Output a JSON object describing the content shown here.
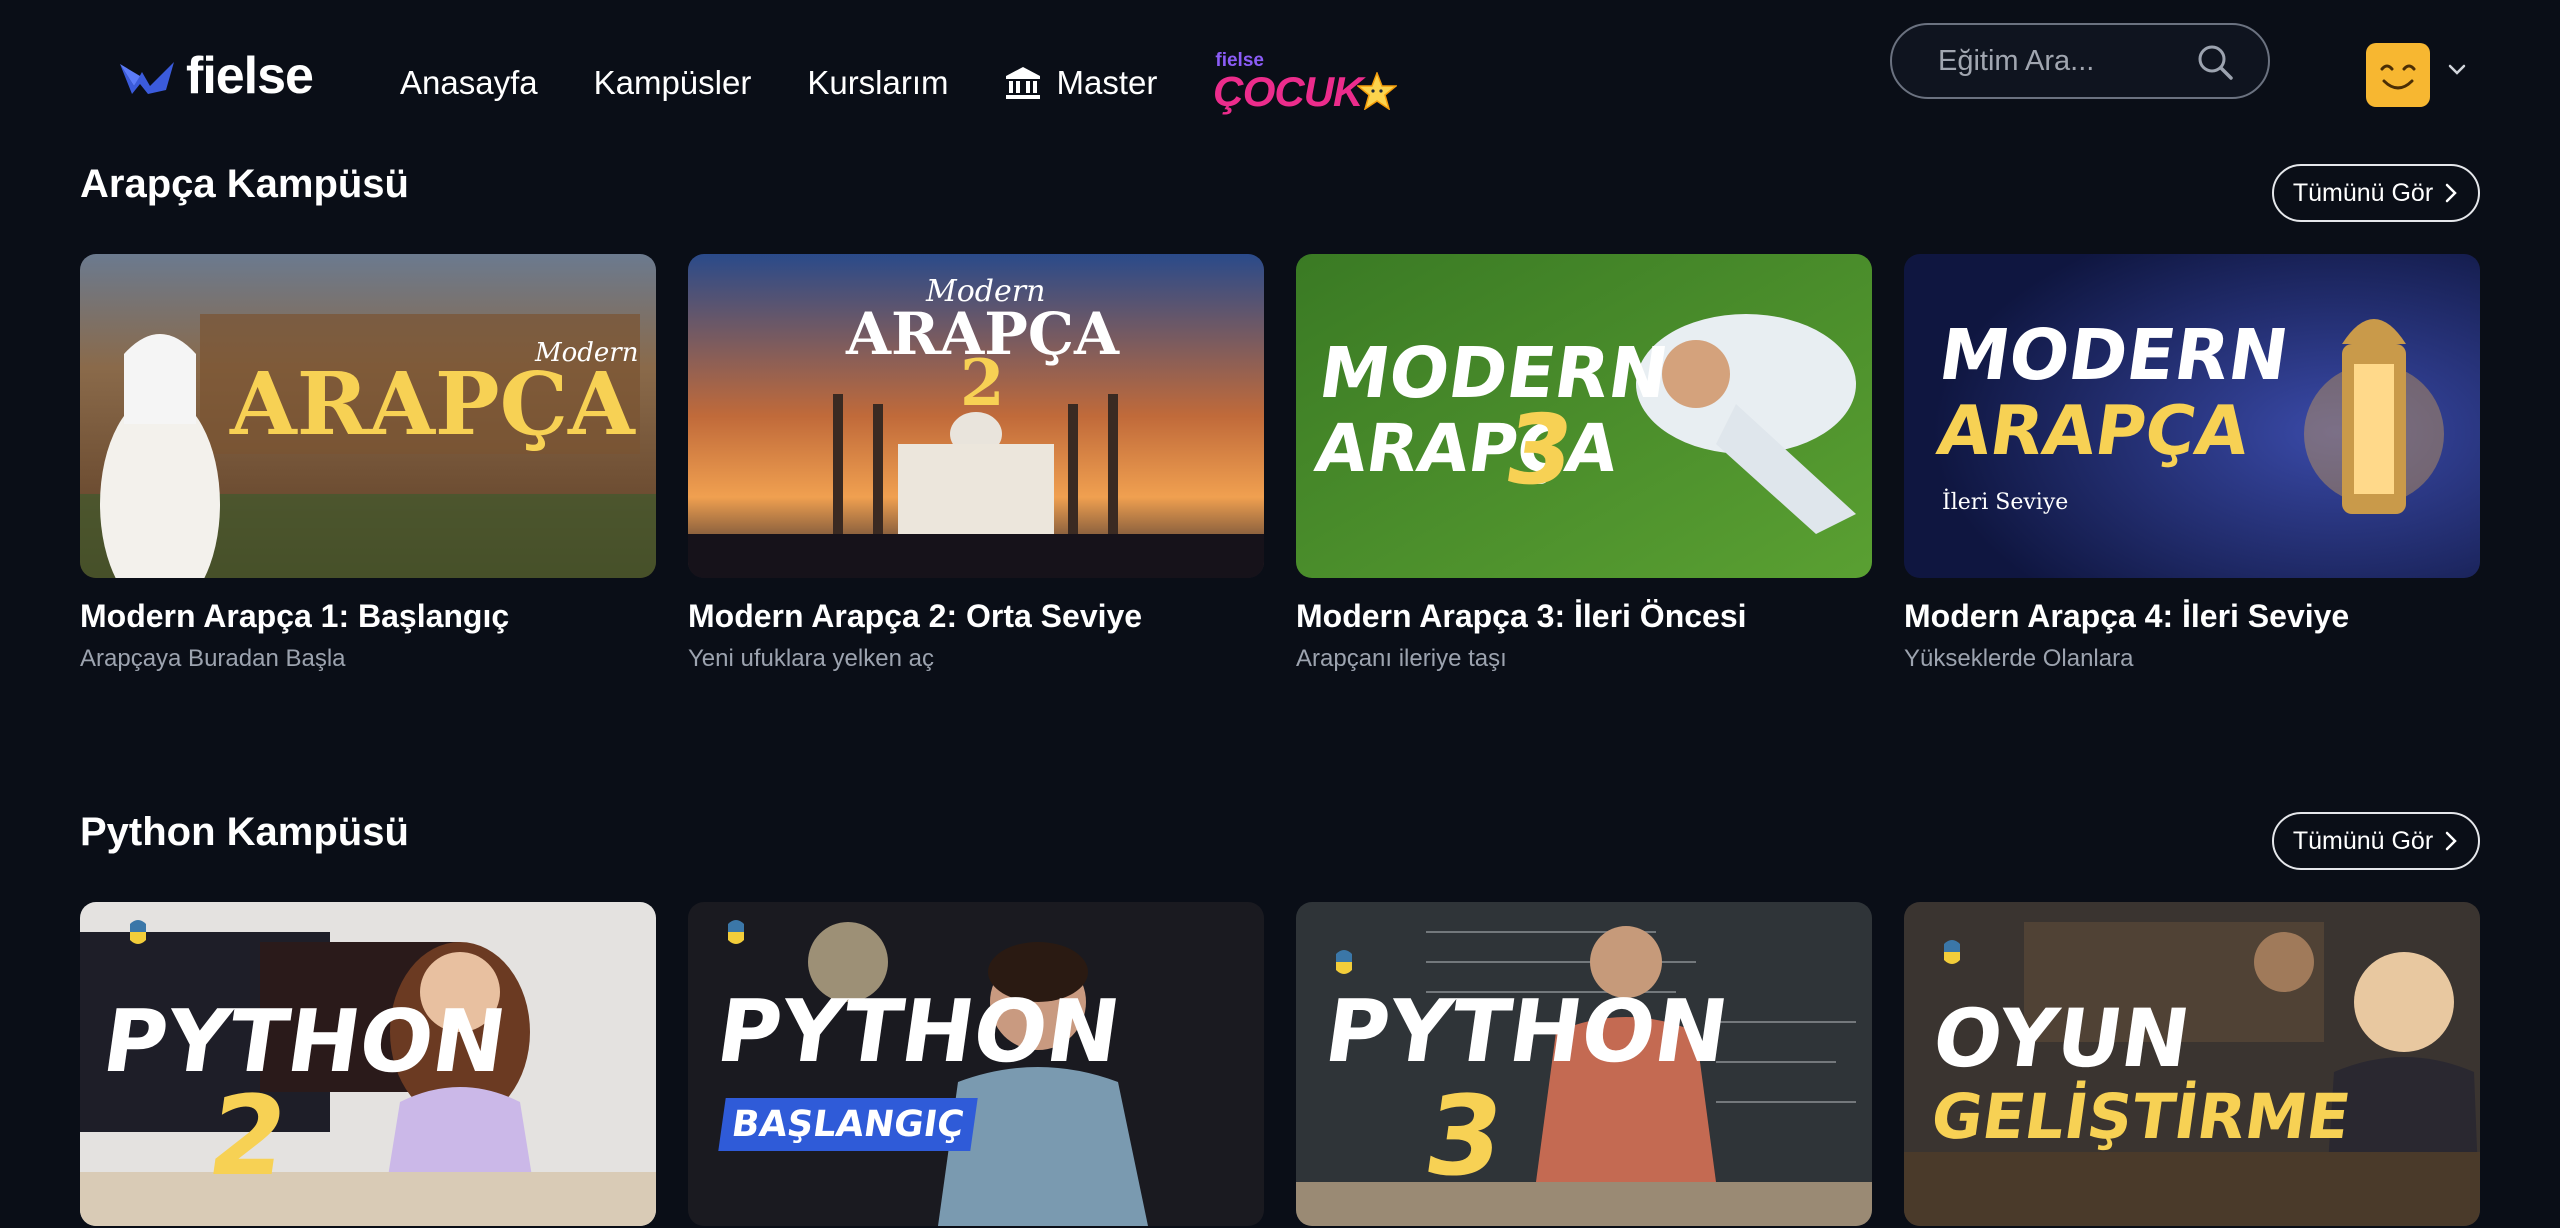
{
  "nav": {
    "logo_text": "fielse",
    "links": [
      "Anasayfa",
      "Kampüsler",
      "Kurslarım"
    ],
    "master_label": "Master",
    "cocuk": {
      "small": "fielse",
      "big": "ÇOCUK"
    },
    "search": {
      "placeholder": "Eğitim Ara..."
    },
    "icons": {
      "search": "search-icon",
      "master": "bank-icon",
      "avatar": "smiley-avatar",
      "chevron": "chevron-down-icon"
    }
  },
  "sections": [
    {
      "title": "Arapça Kampüsü",
      "see_all": "Tümünü Gör",
      "courses": [
        {
          "title": "Modern Arapça 1: Başlangıç",
          "subtitle": "Arapçaya Buradan Başla",
          "thumb_lines": [
            "Modern",
            "ARAPÇA"
          ]
        },
        {
          "title": "Modern Arapça 2: Orta Seviye",
          "subtitle": "Yeni ufuklara yelken aç",
          "thumb_lines": [
            "Modern",
            "ARAPÇA",
            "2"
          ]
        },
        {
          "title": "Modern Arapça 3: İleri Öncesi",
          "subtitle": "Arapçanı ileriye taşı",
          "thumb_lines": [
            "MODERN",
            "ARAPÇA",
            "3"
          ]
        },
        {
          "title": "Modern Arapça 4: İleri Seviye",
          "subtitle": "Yükseklerde Olanlara",
          "thumb_lines": [
            "MODERN",
            "ARAPÇA",
            "İleri Seviye"
          ]
        }
      ]
    },
    {
      "title": "Python Kampüsü",
      "see_all": "Tümünü Gör",
      "courses": [
        {
          "thumb_lines": [
            "PYTHON",
            "2"
          ]
        },
        {
          "thumb_lines": [
            "PYTHON",
            "BAŞLANGIÇ"
          ]
        },
        {
          "thumb_lines": [
            "PYTHON",
            "3"
          ]
        },
        {
          "thumb_lines": [
            "OYUN",
            "GELİŞTİRME"
          ]
        }
      ]
    }
  ]
}
